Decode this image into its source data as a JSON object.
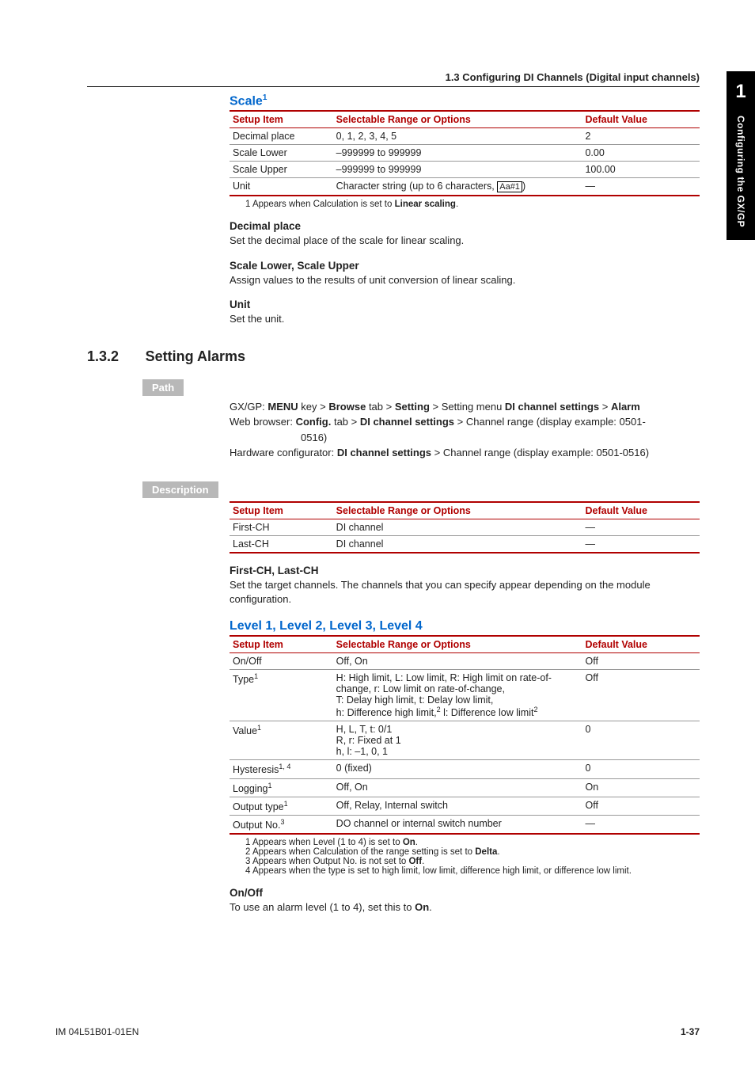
{
  "header": "1.3  Configuring DI Channels (Digital input channels)",
  "sidetab": {
    "num": "1",
    "label": "Configuring the GX/GP"
  },
  "scale": {
    "heading": "Scale",
    "sup": "1",
    "th": {
      "a": "Setup Item",
      "b": "Selectable Range or Options",
      "c": "Default Value"
    },
    "rows": {
      "r1": {
        "a": "Decimal place",
        "b": "0, 1, 2, 3, 4, 5",
        "c": "2"
      },
      "r2": {
        "a": "Scale Lower",
        "b": "–999999 to 999999",
        "c": "0.00"
      },
      "r3": {
        "a": "Scale Upper",
        "b": "–999999 to 999999",
        "c": "100.00"
      },
      "r4": {
        "a": "Unit",
        "b_pre": "Character string (up to 6 characters, ",
        "b_box": "Aa#1",
        "b_post": ")",
        "c": "—"
      }
    },
    "note1": "1  Appears when Calculation is set to ",
    "note1_b": "Linear scaling",
    "note1_post": ".",
    "h_decimal": "Decimal place",
    "t_decimal": "Set the decimal place of the scale for linear scaling.",
    "h_lowup": "Scale Lower, Scale Upper",
    "t_lowup": "Assign values to the results of unit conversion of linear scaling.",
    "h_unit": "Unit",
    "t_unit": "Set the unit."
  },
  "sec132": {
    "num": "1.3.2",
    "title": "Setting Alarms",
    "path_label": "Path",
    "path1_a": "GX/GP: ",
    "path1_b": "MENU",
    "path1_c": " key > ",
    "path1_d": "Browse",
    "path1_e": " tab > ",
    "path1_f": "Setting",
    "path1_g": " > Setting menu ",
    "path1_h": "DI channel settings",
    "path1_i": " > ",
    "path1_j": "Alarm",
    "path2_a": "Web browser: ",
    "path2_b": "Config.",
    "path2_c": " tab > ",
    "path2_d": "DI channel settings",
    "path2_e": " > Channel range (display example: 0501-",
    "path2_sub": "0516)",
    "path3_a": "Hardware configurator: ",
    "path3_b": "DI channel settings",
    "path3_c": " > Channel range (display example: 0501-0516)",
    "desc_label": "Description",
    "desc_th": {
      "a": "Setup Item",
      "b": "Selectable Range or Options",
      "c": "Default Value"
    },
    "desc_rows": {
      "r1": {
        "a": "First-CH",
        "b": "DI channel",
        "c": "—"
      },
      "r2": {
        "a": "Last-CH",
        "b": "DI channel",
        "c": "—"
      }
    },
    "h_fl": "First-CH, Last-CH",
    "t_fl": "Set the target channels. The channels that you can specify appear depending on the module configuration."
  },
  "level": {
    "heading": "Level 1, Level 2, Level 3, Level 4",
    "th": {
      "a": "Setup Item",
      "b": "Selectable Range or Options",
      "c": "Default Value"
    },
    "rows": {
      "r1": {
        "a": "On/Off",
        "b": "Off, On",
        "c": "Off"
      },
      "r2a": "Type",
      "r2a_sup": "1",
      "r2b1": "H: High limit, L: Low limit, R: High limit on rate-of-",
      "r2b2": "change, r: Low limit on rate-of-change,",
      "r2b3": "T: Delay high limit, t: Delay low limit,",
      "r2b4_pre": "h: Difference high limit,",
      "r2b4_sup1": "2",
      "r2b4_mid": " l: Difference low limit",
      "r2b4_sup2": "2",
      "r2c": "Off",
      "r3a": "Value",
      "r3a_sup": "1",
      "r3b1": "H, L, T, t: 0/1",
      "r3b2": "R, r: Fixed at 1",
      "r3b3": "h, l: –1, 0, 1",
      "r3c": "0",
      "r4a": "Hysteresis",
      "r4a_sup": "1, 4",
      "r4b": "0 (fixed)",
      "r4c": "0",
      "r5a": "Logging",
      "r5a_sup": "1",
      "r5b": "Off, On",
      "r5c": "On",
      "r6a": "Output type",
      "r6a_sup": "1",
      "r6b": "Off, Relay, Internal switch",
      "r6c": "Off",
      "r7a": "Output No.",
      "r7a_sup": "3",
      "r7b": "DO channel or internal switch number",
      "r7c": "—"
    },
    "fn1": "1  Appears when Level (1 to 4) is set to ",
    "fn1_b": "On",
    "fn1_post": ".",
    "fn2": "2  Appears when Calculation of the range setting is set to ",
    "fn2_b": "Delta",
    "fn2_post": ".",
    "fn3": "3  Appears when Output No. is not set to ",
    "fn3_b": "Off",
    "fn3_post": ".",
    "fn4": "4  Appears when the type is set to high limit, low limit, difference high limit, or difference low limit.",
    "h_onoff": "On/Off",
    "t_onoff_pre": "To use an alarm level (1 to 4), set this to ",
    "t_onoff_b": "On",
    "t_onoff_post": "."
  },
  "footer": {
    "left": "IM 04L51B01-01EN",
    "right": "1-37"
  }
}
